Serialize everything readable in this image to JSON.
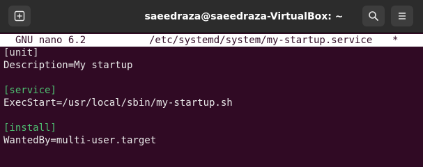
{
  "window": {
    "title": "saeedraza@saeedraza-VirtualBox: ~",
    "icons": {
      "new_tab": "new-tab-icon",
      "search": "search-icon",
      "menu": "hamburger-menu-icon"
    }
  },
  "nano": {
    "app": "GNU nano 6.2",
    "path": "/etc/systemd/system/my-startup.service",
    "modified_marker": "*"
  },
  "file": {
    "lines": [
      "[unit]",
      "Description=My startup",
      "",
      "[service]",
      "ExecStart=/usr/local/sbin/my-startup.sh",
      "",
      "[install]",
      "WantedBy=multi-user.target"
    ]
  },
  "colors": {
    "terminal_bg": "#300a24",
    "section_header": "#4ebf71",
    "titlebar_bg": "#2c2c2c"
  }
}
